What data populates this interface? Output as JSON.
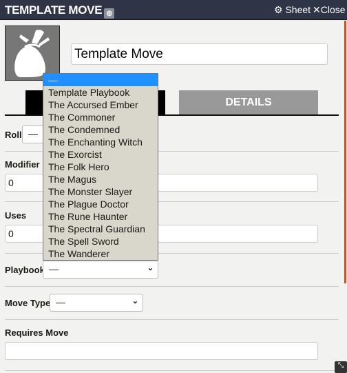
{
  "header": {
    "title": "TEMPLATE MOVE",
    "sheet_label": "Sheet",
    "close_label": "Close"
  },
  "name_value": "Template Move",
  "tabs": [
    {
      "label": ""
    },
    {
      "label": "DETAILS"
    }
  ],
  "fields": {
    "roll_label": "Roll",
    "roll_value": "—",
    "modifier_label": "Modifier",
    "modifier_value": "0",
    "uses_label": "Uses",
    "uses_value": "0",
    "playbook_label": "Playbook",
    "playbook_value": "—",
    "move_type_label": "Move Type",
    "move_type_value": "—",
    "requires_label": "Requires Move",
    "requires_value": ""
  },
  "dropdown": {
    "options": [
      "—",
      "Template Playbook",
      "The Accursed Ember",
      "The Commoner",
      "The Condemned",
      "The Enchanting Witch",
      "The Exorcist",
      "The Folk Hero",
      "The Magus",
      "The Monster Slayer",
      "The Plague Doctor",
      "The Rune Haunter",
      "The Spectral Guardian",
      "The Spell Sword",
      "The Wanderer"
    ],
    "selected_index": 0
  },
  "colors": {
    "header": "#2f3547",
    "highlight": "#1e90ff",
    "accent": "#c9541d"
  }
}
